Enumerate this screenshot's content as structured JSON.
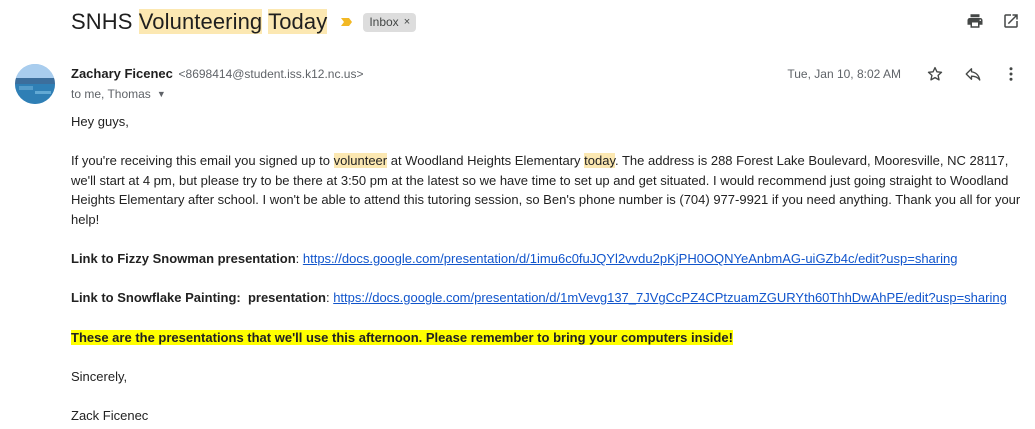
{
  "subject": {
    "part1": "SNHS ",
    "part2": "Volunteering",
    "part3": " ",
    "part4": "Today"
  },
  "label": {
    "text": "Inbox",
    "remove": "×"
  },
  "sender": {
    "name": "Zachary Ficenec",
    "email": "<8698414@student.iss.k12.nc.us>"
  },
  "recipients": "to me, Thomas",
  "date": "Tue, Jan 10, 8:02 AM",
  "body": {
    "greeting": "Hey guys,",
    "p1_a": "If you're receiving this email you signed up to ",
    "p1_b": "volunteer",
    "p1_c": " at Woodland Heights Elementary ",
    "p1_d": "today",
    "p1_e": ". The address is 288 Forest Lake Boulevard, Mooresville, NC 28117, we'll start at 4 pm, but please try to be there at 3:50 pm at the latest so we have time to set up and get situated. I would recommend just going straight to Woodland Heights Elementary after school. I won't be able to attend this tutoring session, so Ben's phone number is (704) 977-9921 if you need anything. Thank you all for your help!",
    "link1_label": "Link to Fizzy Snowman presentation",
    "link1_sep": ": ",
    "link1_url": "https://docs.google.com/presentation/d/1imu6c0fuJQYl2vvdu2pKjPH0OQNYeAnbmAG-uiGZb4c/edit?usp=sharing",
    "link2_label": "Link to Snowflake Painting:  presentation",
    "link2_sep": ": ",
    "link2_url": "https://docs.google.com/presentation/d/1mVevg137_7JVgCcPZ4CPtzuamZGURYth60ThhDwAhPE/edit?usp=sharing",
    "highlight": "These are the presentations that we'll use this afternoon. Please remember to bring your computers inside!",
    "closing": "Sincerely,",
    "signature": "Zack Ficenec"
  },
  "icons": [
    "print-icon",
    "open-in-new-window-icon",
    "star-icon",
    "reply-icon",
    "more-vert-icon",
    "important-marker-icon",
    "caret-down-icon"
  ],
  "colors": {
    "subject_highlight": "#fce8b2",
    "yellow_highlight": "#ffff00",
    "link": "#1155cc",
    "important": "#f2b824"
  }
}
